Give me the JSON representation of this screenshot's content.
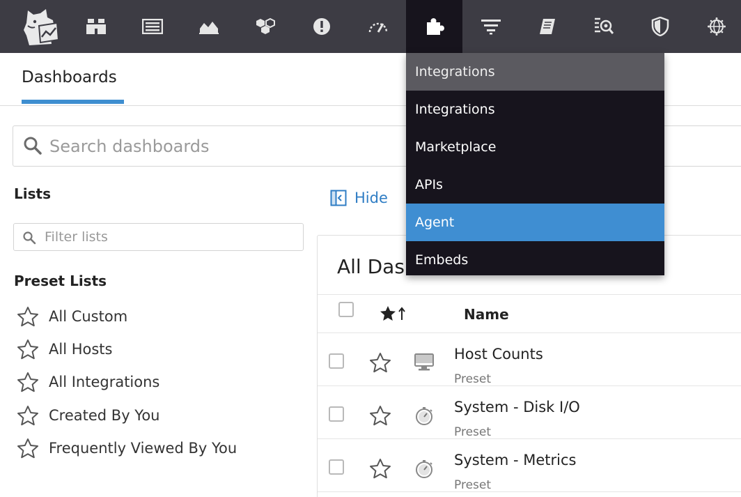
{
  "topnav": {
    "items": [
      {
        "icon": "binoculars-icon"
      },
      {
        "icon": "event-stream-icon"
      },
      {
        "icon": "area-chart-icon"
      },
      {
        "icon": "infrastructure-hexagon-icon"
      },
      {
        "icon": "alert-icon"
      },
      {
        "icon": "apm-gauge-icon"
      },
      {
        "icon": "puzzle-piece-icon"
      },
      {
        "icon": "logs-filter-icon"
      },
      {
        "icon": "notebook-icon"
      },
      {
        "icon": "synthetics-icon"
      },
      {
        "icon": "security-shield-icon"
      },
      {
        "icon": "rum-globe-icon"
      }
    ],
    "active_index": 6,
    "colors": {
      "bar": "#3d3c44",
      "active": "#17141d"
    }
  },
  "dropdown": {
    "header": "Integrations",
    "items": [
      "Integrations",
      "Marketplace",
      "APIs",
      "Agent",
      "Embeds"
    ],
    "selected": "Agent",
    "colors": {
      "background": "#17141d",
      "header": "#5b5a60",
      "selected": "#3f8ed2"
    }
  },
  "page": {
    "tab": "Dashboards",
    "search_placeholder": "Search dashboards"
  },
  "lists": {
    "heading": "Lists",
    "filter_placeholder": "Filter lists",
    "hide_label": "Hide",
    "preset_heading": "Preset Lists",
    "preset_items": [
      "All Custom",
      "All Hosts",
      "All Integrations",
      "Created By You",
      "Frequently Viewed By You"
    ]
  },
  "main": {
    "title": "All Das",
    "columns": {
      "name": "Name"
    },
    "rows": [
      {
        "name": "Host Counts",
        "sub": "Preset",
        "icon": "monitor-icon"
      },
      {
        "name": "System - Disk I/O",
        "sub": "Preset",
        "icon": "stopwatch-icon"
      },
      {
        "name": "System - Metrics",
        "sub": "Preset",
        "icon": "stopwatch-icon"
      }
    ]
  },
  "accent_color": "#3e8ed0"
}
